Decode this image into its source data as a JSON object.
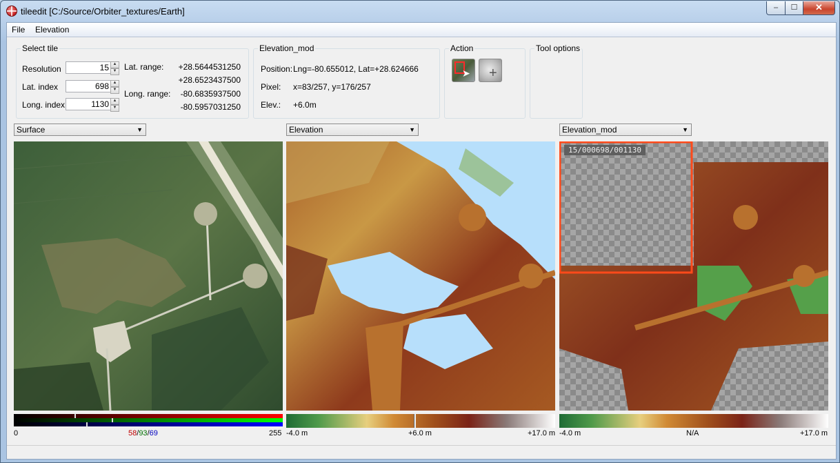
{
  "window": {
    "title": "tileedit [C:/Source/Orbiter_textures/Earth]",
    "minimize": "‒",
    "maximize": "☐",
    "close": "✕"
  },
  "menu": {
    "file": "File",
    "elevation": "Elevation"
  },
  "select_tile": {
    "title": "Select tile",
    "resolution_label": "Resolution",
    "resolution_value": "15",
    "lat_index_label": "Lat. index",
    "lat_index_value": "698",
    "long_index_label": "Long. index",
    "long_index_value": "1130",
    "lat_range_label": "Lat. range:",
    "lat_range_max": "+28.5644531250",
    "lat_range_min": "+28.6523437500",
    "long_range_label": "Long. range:",
    "long_range_min": "-80.6835937500",
    "long_range_max": "-80.5957031250"
  },
  "elevation_mod": {
    "title": "Elevation_mod",
    "position_label": "Position:",
    "position_value": "Lng=-80.655012, Lat=+28.624666",
    "pixel_label": "Pixel:",
    "pixel_value": "x=83/257, y=176/257",
    "elev_label": "Elev.:",
    "elev_value": "+6.0m"
  },
  "action": {
    "title": "Action"
  },
  "tool_options": {
    "title": "Tool options"
  },
  "panels": {
    "left": {
      "combo": "Surface",
      "scale_min": "0",
      "r": "58",
      "sep1": "/",
      "g": "93",
      "sep2": "/",
      "b": "69",
      "scale_max": "255"
    },
    "middle": {
      "combo": "Elevation",
      "scale_min": "-4.0 m",
      "scale_mid": "+6.0 m",
      "scale_max": "+17.0 m"
    },
    "right": {
      "combo": "Elevation_mod",
      "tile_id": "15/000698/001130",
      "scale_min": "-4.0 m",
      "scale_mid": "N/A",
      "scale_max": "+17.0 m"
    }
  },
  "colors": {
    "r_value": "#c00000",
    "g_value": "#007000",
    "b_value": "#0000c0",
    "selection": "#ff4a1a",
    "water": "#b7dffb"
  }
}
